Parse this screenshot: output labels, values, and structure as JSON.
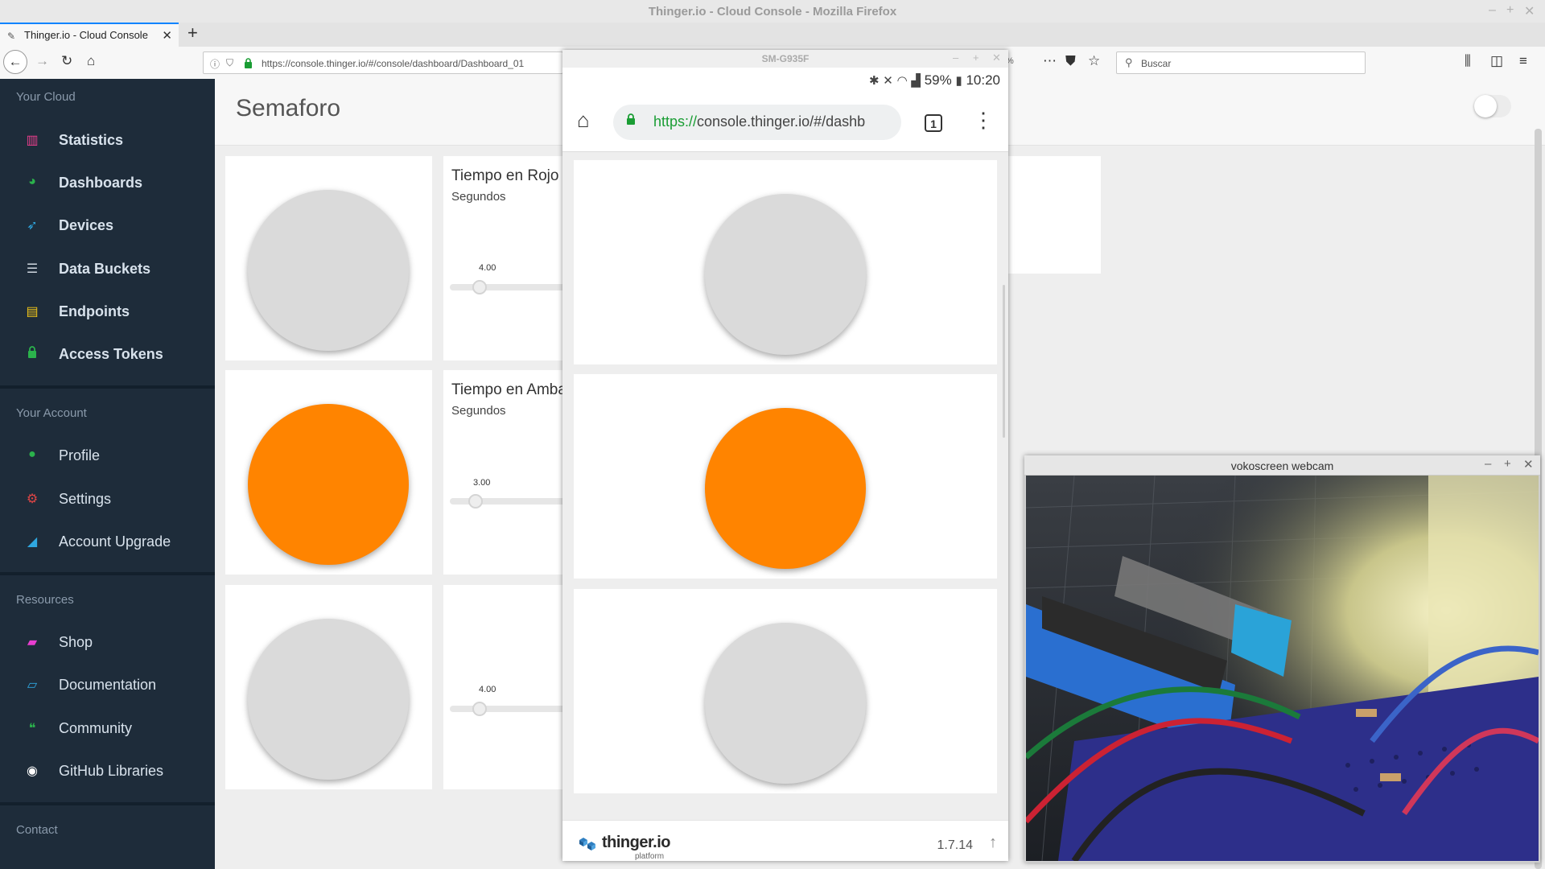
{
  "window": {
    "title": "Thinger.io - Cloud Console - Mozilla Firefox"
  },
  "browser": {
    "tab_label": "Thinger.io - Cloud Console",
    "url": "https://console.thinger.io/#/console/dashboard/Dashboard_01",
    "search_placeholder": "Buscar",
    "zoom_fragment": "%"
  },
  "sidebar": {
    "sections": [
      {
        "label": "Your Cloud",
        "items": [
          {
            "label": "Statistics",
            "icon": "bar-chart-icon",
            "color": "#e83e8c"
          },
          {
            "label": "Dashboards",
            "icon": "gauge-icon",
            "color": "#2bb24c"
          },
          {
            "label": "Devices",
            "icon": "rocket-icon",
            "color": "#2fa7e0"
          },
          {
            "label": "Data Buckets",
            "icon": "database-icon",
            "color": "#d0d8e0"
          },
          {
            "label": "Endpoints",
            "icon": "server-icon",
            "color": "#f0c419"
          },
          {
            "label": "Access Tokens",
            "icon": "lock-icon",
            "color": "#2bb24c"
          }
        ]
      },
      {
        "label": "Your Account",
        "items": [
          {
            "label": "Profile",
            "icon": "user-icon",
            "color": "#2bb24c"
          },
          {
            "label": "Settings",
            "icon": "cogs-icon",
            "color": "#e04545"
          },
          {
            "label": "Account Upgrade",
            "icon": "area-chart-icon",
            "color": "#2fa7e0"
          }
        ]
      },
      {
        "label": "Resources",
        "items": [
          {
            "label": "Shop",
            "icon": "shopping-bag-icon",
            "color": "#e83ed0"
          },
          {
            "label": "Documentation",
            "icon": "book-icon",
            "color": "#2fa7e0"
          },
          {
            "label": "Community",
            "icon": "comments-icon",
            "color": "#2bb24c"
          },
          {
            "label": "GitHub Libraries",
            "icon": "github-icon",
            "color": "#ffffff"
          }
        ]
      },
      {
        "label": "Contact",
        "items": []
      }
    ]
  },
  "dashboard": {
    "title": "Semaforo",
    "widgets": [
      {
        "led_state": "off",
        "timer_title": "Tiempo en Rojo",
        "timer_unit": "Segundos",
        "slider_value": "4.00"
      },
      {
        "led_state": "on",
        "timer_title": "Tiempo en Amba",
        "timer_unit": "Segundos",
        "slider_value": "3.00"
      },
      {
        "led_state": "off",
        "timer_title": "",
        "timer_unit": "",
        "slider_value": "4.00"
      }
    ]
  },
  "phone": {
    "device_name": "SM-G935F",
    "status": {
      "battery": "59%",
      "time": "10:20"
    },
    "url_scheme": "https://",
    "url_rest": "console.thinger.io/#/dashb",
    "tab_count": "1",
    "leds": [
      "off",
      "on",
      "off"
    ],
    "footer": {
      "logo": "thinger.io",
      "logo_sub": "platform",
      "version": "1.7.14"
    }
  },
  "webcam": {
    "title": "vokoscreen webcam"
  },
  "colors": {
    "sidebar_bg": "#1e2c3a",
    "led_on": "#ff8400",
    "led_off": "#dadada",
    "ssl_green": "#1a9d34"
  }
}
